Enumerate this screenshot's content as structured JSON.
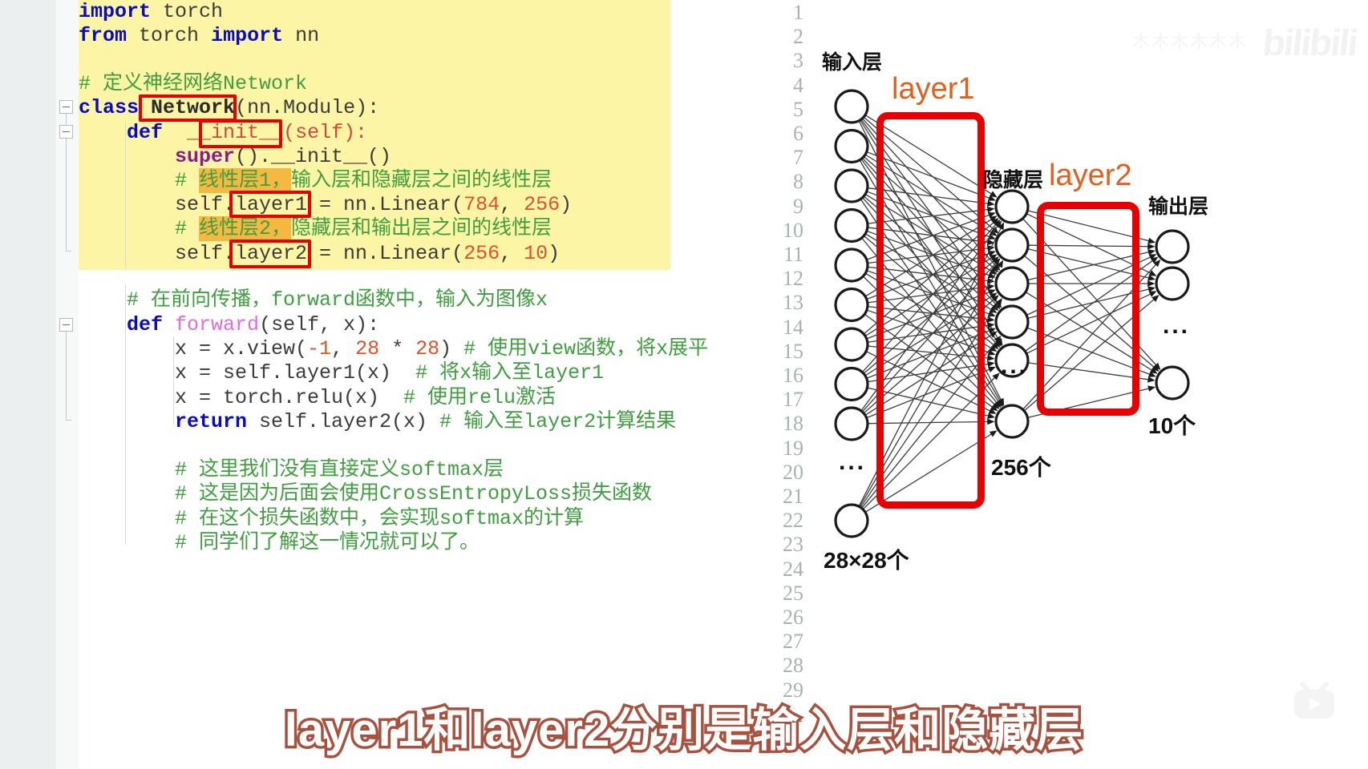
{
  "editor": {
    "line_numbers": [
      1,
      2,
      3,
      4,
      5,
      6,
      7,
      8,
      9,
      10,
      11,
      12,
      13,
      14,
      15,
      16,
      17,
      18,
      19,
      20,
      21,
      22,
      23,
      24,
      25,
      26,
      27,
      28,
      29
    ],
    "code_lines": [
      {
        "n": 1,
        "text": "import torch"
      },
      {
        "n": 2,
        "text": "from torch import nn"
      },
      {
        "n": 3,
        "text": ""
      },
      {
        "n": 4,
        "text": "# 定义神经网络Network"
      },
      {
        "n": 5,
        "text": "class Network(nn.Module):"
      },
      {
        "n": 6,
        "text": "    def __init__(self):"
      },
      {
        "n": 7,
        "text": "        super().__init__()"
      },
      {
        "n": 8,
        "text": "        # 线性层1，输入层和隐藏层之间的线性层"
      },
      {
        "n": 9,
        "text": "        self.layer1 = nn.Linear(784, 256)"
      },
      {
        "n": 10,
        "text": "        # 线性层2，隐藏层和输出层之间的线性层"
      },
      {
        "n": 11,
        "text": "        self.layer2 = nn.Linear(256, 10)"
      },
      {
        "n": 12,
        "text": ""
      },
      {
        "n": 13,
        "text": "    # 在前向传播，forward函数中，输入为图像x"
      },
      {
        "n": 14,
        "text": "    def forward(self, x):"
      },
      {
        "n": 15,
        "text": "        x = x.view(-1, 28 * 28) # 使用view函数，将x展平"
      },
      {
        "n": 16,
        "text": "        x = self.layer1(x)  # 将x输入至layer1"
      },
      {
        "n": 17,
        "text": "        x = torch.relu(x)  # 使用relu激活"
      },
      {
        "n": 18,
        "text": "        return self.layer2(x) # 输入至layer2计算结果"
      },
      {
        "n": 19,
        "text": ""
      },
      {
        "n": 20,
        "text": "        # 这里我们没有直接定义softmax层"
      },
      {
        "n": 21,
        "text": "        # 这是因为后面会使用CrossEntropyLoss损失函数"
      },
      {
        "n": 22,
        "text": "        # 在这个损失函数中，会实现softmax的计算"
      },
      {
        "n": 23,
        "text": "        # 同学们了解这一情况就可以了。"
      },
      {
        "n": 24,
        "text": ""
      },
      {
        "n": 25,
        "text": ""
      },
      {
        "n": 26,
        "text": ""
      },
      {
        "n": 27,
        "text": ""
      },
      {
        "n": 28,
        "text": ""
      },
      {
        "n": 29,
        "text": ""
      }
    ],
    "tokens": {
      "import": "import",
      "torch": "torch",
      "from": "from",
      "nn": "nn",
      "comment4": "# 定义神经网络Network",
      "class": "class",
      "network": "Network",
      "nn_module": "(nn.Module):",
      "def": "def",
      "init_pre": "__",
      "init": "init",
      "init_post": "__(self):",
      "super": "super",
      "super_rest": "().__init__()",
      "comment8_hl": "线性层1，",
      "comment8_rest": "输入层和隐藏层之间的线性层",
      "comment10_hl": "线性层2，",
      "comment10_rest": "隐藏层和输出层之间的线性层",
      "self_dot": "self.",
      "layer1": "layer1",
      "layer1_rest": " = nn.Linear(",
      "n784": "784",
      "comma": ", ",
      "n256": "256",
      "paren": ")",
      "layer2": "layer2",
      "layer2_rest": " = nn.Linear(",
      "n256b": "256",
      "n10": "10",
      "comment13": "# 在前向传播，forward函数中，输入为图像x",
      "forward": "forward",
      "forward_rest": "(self, x):",
      "l15a": "x = x.view(",
      "l15neg1": "-1",
      "l15b": ", ",
      "l15_28a": "28",
      "l15star": " * ",
      "l15_28b": "28",
      "l15c": ") ",
      "l15cm": "# 使用view函数，将x展平",
      "l16a": "x = self.layer1(x)  ",
      "l16cm": "# 将x输入至layer1",
      "l17a": "x = torch.relu(x)  ",
      "l17cm": "# 使用relu激活",
      "return": "return",
      "l18a": " self.layer2(x) ",
      "l18cm": "# 输入至layer2计算结果",
      "c20": "# 这里我们没有直接定义softmax层",
      "c21": "# 这是因为后面会使用CrossEntropyLoss损失函数",
      "c22": "# 在这个损失函数中，会实现softmax的计算",
      "c23": "# 同学们了解这一情况就可以了。"
    },
    "colors": {
      "highlight_block": "#fdf5a6",
      "highlight_orange": "#f5b942",
      "redbox": "#e60000",
      "keyword": "#0a0ac4",
      "comment": "#3f9e3f",
      "number": "#e2502a",
      "gutter": "#eceff0"
    }
  },
  "diagram": {
    "title_input": "输入层",
    "title_hidden": "隐藏层",
    "title_output": "输出层",
    "label_layer1": "layer1",
    "label_layer2": "layer2",
    "count_input": "28×28个",
    "count_hidden": "256个",
    "count_output": "10个",
    "ellipsis": "...",
    "colors": {
      "box": "#e60000",
      "layer_label": "#e2601d",
      "node_stroke": "#1a1a1a",
      "edge": "#3c3c3c"
    },
    "structure": {
      "input_nodes_visible": 9,
      "input_node_after_ellipsis": 1,
      "hidden_nodes_visible": 5,
      "hidden_node_after_ellipsis": 1,
      "output_nodes_visible": 2,
      "output_node_after_ellipsis": 1
    }
  },
  "watermark": {
    "brand": "bilibili",
    "uploader": "木木木木木木",
    "tv_icon": "bilibili-tv-icon"
  },
  "subtitle": {
    "text": "layer1和layer2分别是输入层和隐藏层",
    "fill": "#ffffff",
    "stroke": "#a9513f"
  }
}
